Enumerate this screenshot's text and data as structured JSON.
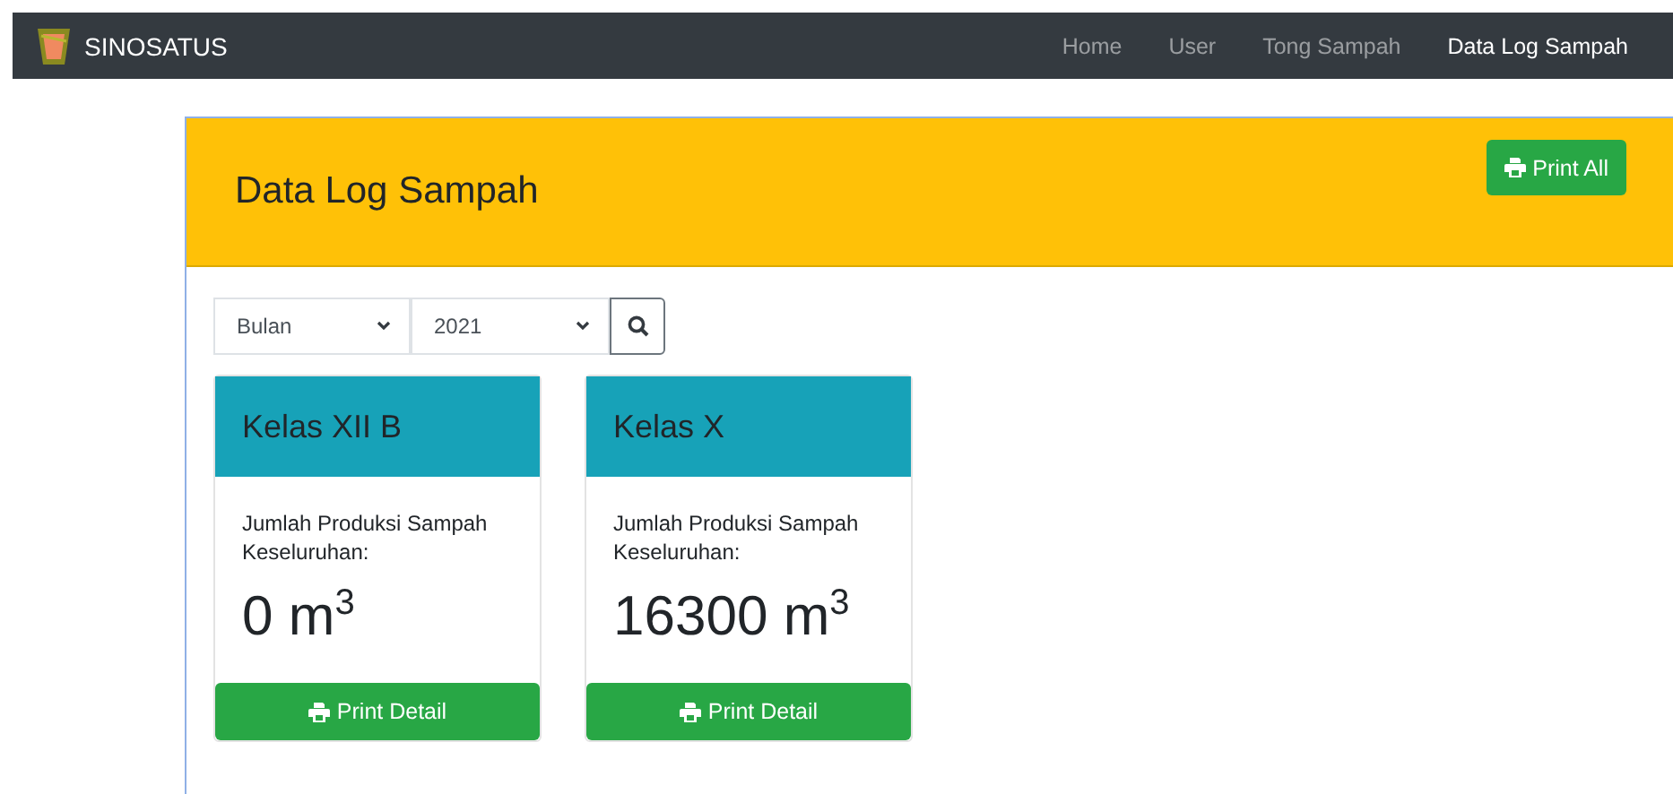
{
  "navbar": {
    "brand": "SINOSATUS",
    "links": [
      {
        "label": "Home",
        "selected": false
      },
      {
        "label": "User",
        "selected": false
      },
      {
        "label": "Tong Sampah",
        "selected": false
      },
      {
        "label": "Data Log Sampah",
        "selected": true
      }
    ]
  },
  "page": {
    "title": "Data Log Sampah",
    "print_all": "Print All"
  },
  "filters": {
    "month": "Bulan",
    "year": "2021"
  },
  "cards": [
    {
      "title": "Kelas XII B",
      "label": "Jumlah Produksi Sampah Keseluruhan:",
      "value": "0 m$^{3}$",
      "button": "Print Detail"
    },
    {
      "title": "Kelas X",
      "label": "Jumlah Produksi Sampah Keseluruhan:",
      "value": "16300 m$^{3}$",
      "button": "Print Detail"
    }
  ]
}
